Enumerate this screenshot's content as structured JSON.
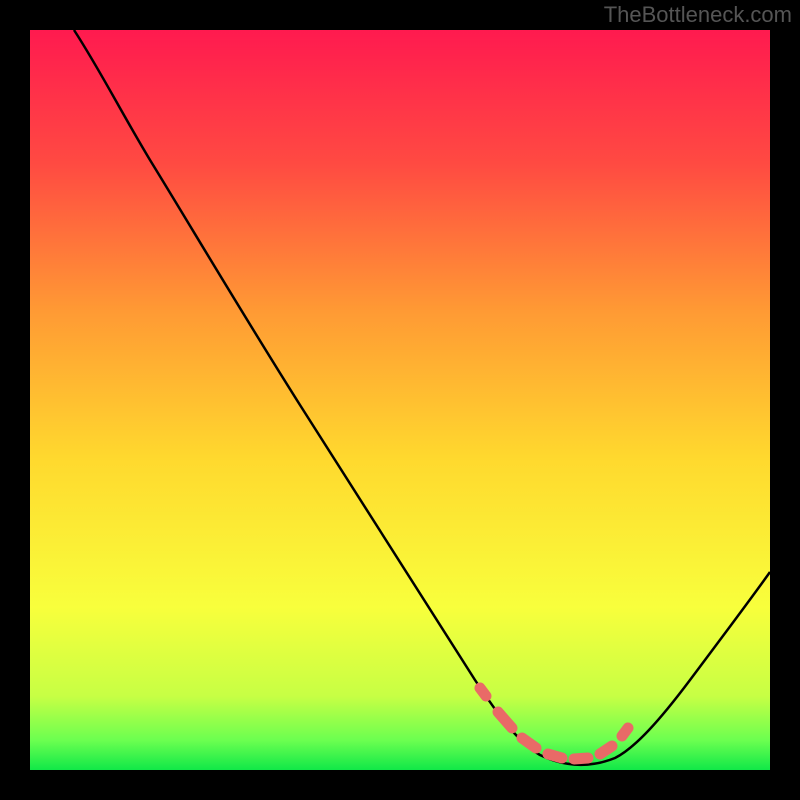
{
  "watermark": "TheBottleneck.com",
  "chart_data": {
    "type": "line",
    "title": "",
    "xlabel": "",
    "ylabel": "",
    "xlim": [
      0,
      100
    ],
    "ylim": [
      0,
      100
    ],
    "grid": false,
    "legend": false,
    "note": "Values are estimated from pixel geometry (no axis ticks present). x is horizontal position within the colored plot area (0=left edge, 100=right edge). y is vertical position (0=bottom edge, 100=top edge).",
    "series": [
      {
        "name": "bottleneck-curve",
        "stroke": "#000000",
        "x": [
          6,
          10,
          15,
          20,
          25,
          30,
          35,
          40,
          45,
          50,
          55,
          60,
          61,
          63,
          65,
          67,
          70,
          73,
          76,
          79,
          80,
          82,
          85,
          88,
          91,
          94,
          97,
          100
        ],
        "y": [
          100,
          95,
          88,
          80,
          72.5,
          65,
          57,
          49.5,
          42,
          34,
          26,
          18,
          16.5,
          13,
          10,
          7,
          4,
          2.2,
          1.5,
          1.5,
          1.8,
          2.8,
          5.5,
          9.5,
          14,
          19,
          24,
          29
        ]
      },
      {
        "name": "optimal-range-marker",
        "stroke": "#e96a67",
        "style": "thick-dashed",
        "x": [
          61,
          63,
          65,
          67,
          70,
          73,
          76,
          79,
          80
        ],
        "y": [
          16.5,
          13,
          10,
          7,
          4,
          2.2,
          1.5,
          1.5,
          1.8
        ]
      }
    ],
    "background_gradient_top_to_bottom": [
      "#ff1a4f",
      "#ff6a3a",
      "#ffb030",
      "#ffe52e",
      "#f7ff3a",
      "#9bff55",
      "#18e84b"
    ],
    "plot_frame": {
      "border_color": "#000000",
      "border_width_px": 30
    }
  }
}
